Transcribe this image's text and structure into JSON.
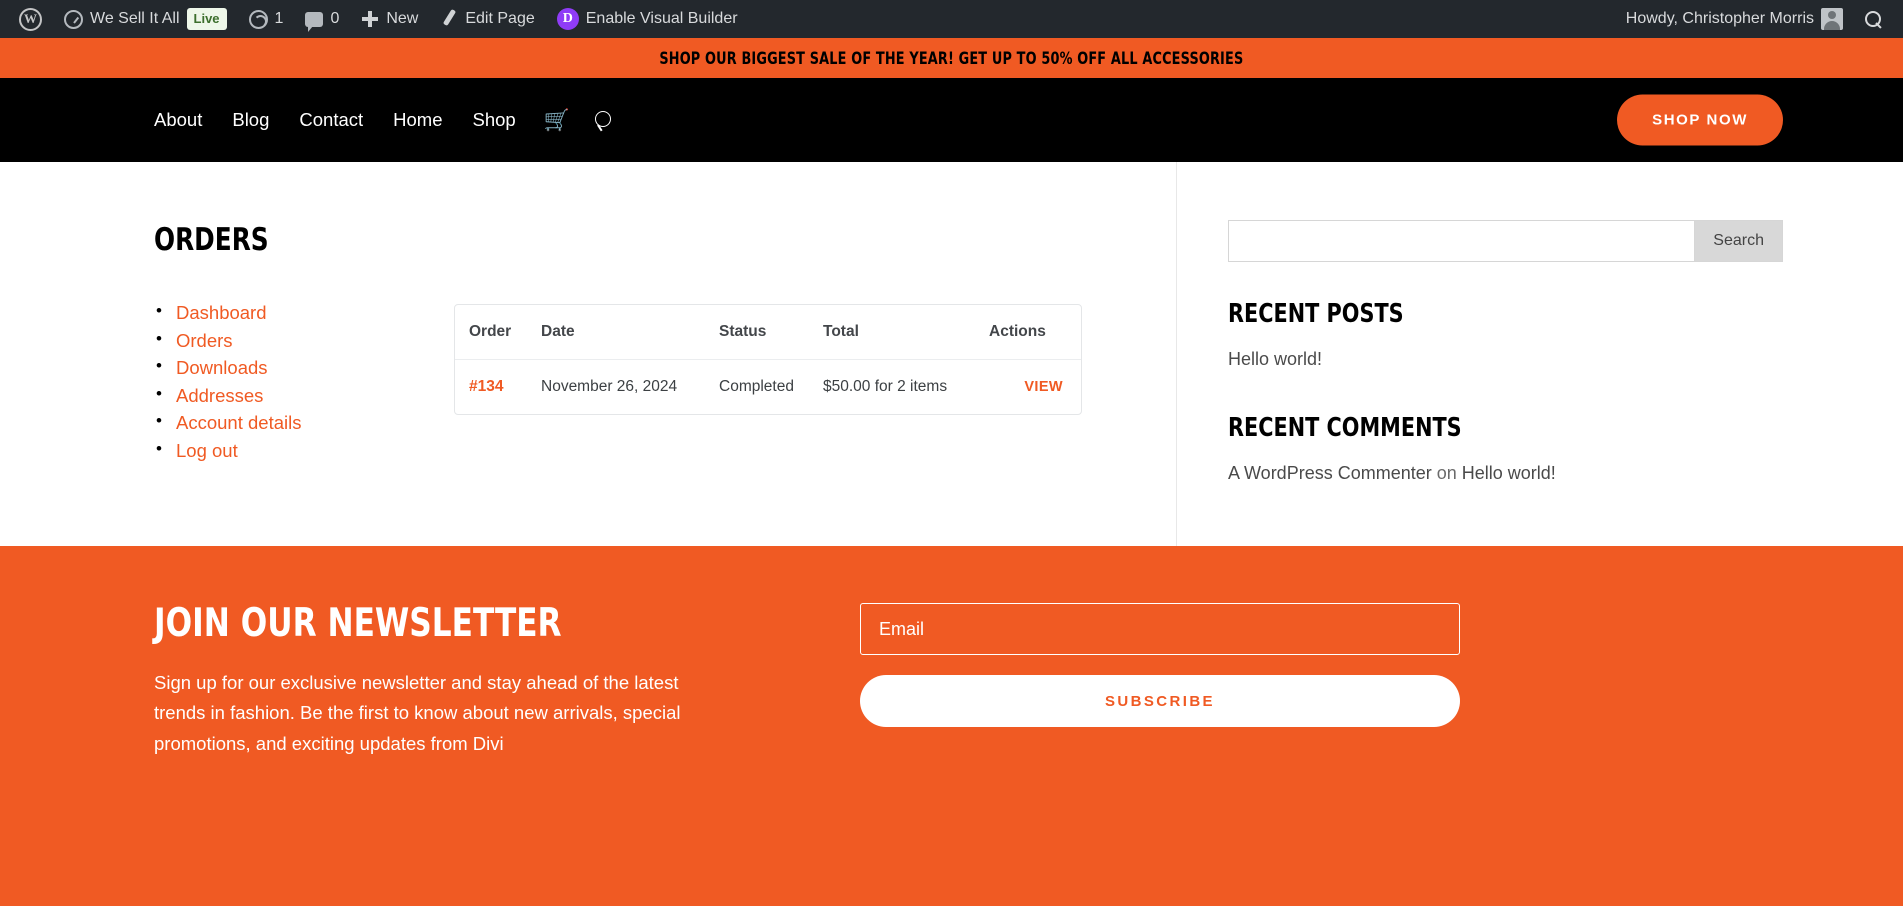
{
  "adminbar": {
    "site_name": "We Sell It All",
    "live_badge": "Live",
    "revisions_count": "1",
    "comments_count": "0",
    "new_label": "New",
    "edit_page_label": "Edit Page",
    "divi_initial": "D",
    "visual_builder_label": "Enable Visual Builder",
    "howdy": "Howdy, Christopher Morris"
  },
  "promo": {
    "text": "SHOP OUR BIGGEST SALE OF THE YEAR! GET UP TO 50% OFF ALL ACCESSORIES",
    "bg": "#f05a23",
    "fg": "#000000"
  },
  "nav": {
    "items": [
      {
        "label": "About"
      },
      {
        "label": "Blog"
      },
      {
        "label": "Contact"
      },
      {
        "label": "Home"
      },
      {
        "label": "Shop"
      }
    ],
    "cart_glyph": "🛒",
    "cta_label": "SHOP NOW",
    "accent": "#f05a23"
  },
  "main": {
    "title": "ORDERS",
    "account_nav": [
      {
        "label": "Dashboard"
      },
      {
        "label": "Orders"
      },
      {
        "label": "Downloads"
      },
      {
        "label": "Addresses"
      },
      {
        "label": "Account details"
      },
      {
        "label": "Log out"
      }
    ],
    "orders_table": {
      "columns": [
        "Order",
        "Date",
        "Status",
        "Total",
        "Actions"
      ],
      "rows": [
        {
          "order": "#134",
          "date": "November 26, 2024",
          "status": "Completed",
          "total": "$50.00 for 2 items",
          "action": "VIEW"
        }
      ]
    }
  },
  "sidebar": {
    "search": {
      "value": "",
      "placeholder": "",
      "button_label": "Search"
    },
    "recent_posts": {
      "title": "RECENT POSTS",
      "items": [
        {
          "label": "Hello world!"
        }
      ]
    },
    "recent_comments": {
      "title": "RECENT COMMENTS",
      "items": [
        {
          "author": "A WordPress Commenter",
          "connector": " on ",
          "post": "Hello world!"
        }
      ]
    }
  },
  "newsletter": {
    "title": "JOIN OUR NEWSLETTER",
    "body": "Sign up for our exclusive newsletter and stay ahead of the latest trends in fashion. Be the first to know about new arrivals, special promotions, and exciting updates from Divi",
    "email_value": "",
    "email_placeholder": "Email",
    "subscribe_label": "SUBSCRIBE",
    "bg": "#f05a23"
  }
}
